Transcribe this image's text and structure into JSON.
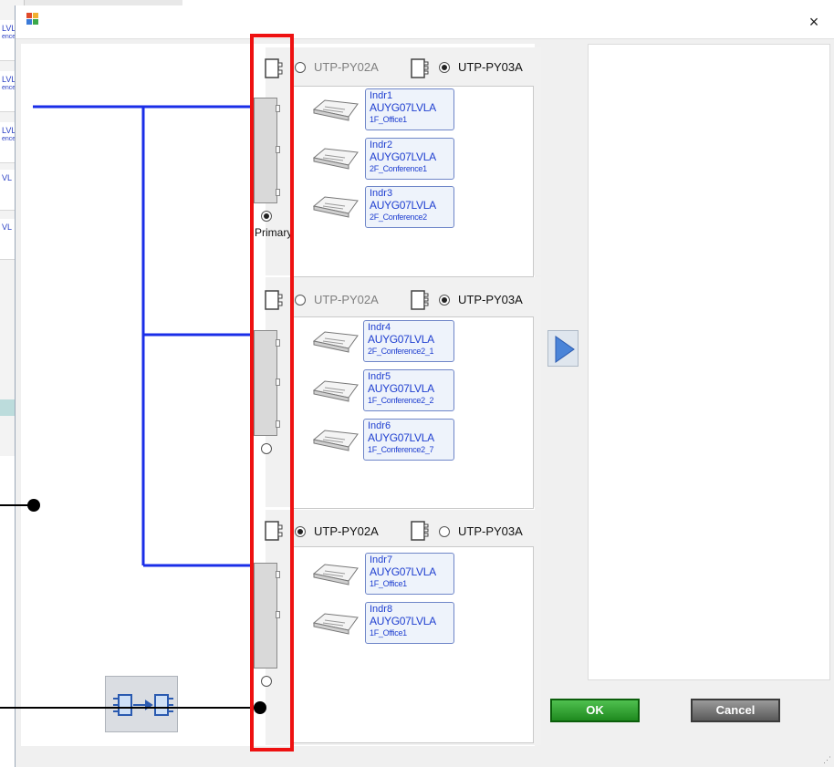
{
  "background_window": {
    "items": [
      {
        "line1": "LVL",
        "line2": "ence"
      },
      {
        "line1": "LVL",
        "line2": "ence"
      },
      {
        "line1": "LVL",
        "line2": "ence"
      },
      {
        "line1": "VL",
        "line2": ""
      },
      {
        "line1": "VL",
        "line2": ""
      }
    ]
  },
  "dialog": {
    "close_glyph": "×"
  },
  "groups": [
    {
      "options": [
        {
          "label": "UTP-PY02A",
          "selected": false,
          "dim": true
        },
        {
          "label": "UTP-PY03A",
          "selected": true,
          "dim": false
        }
      ],
      "units": [
        {
          "name": "Indr1",
          "model": "AUYG07LVLA",
          "room": "1F_Office1"
        },
        {
          "name": "Indr2",
          "model": "AUYG07LVLA",
          "room": "2F_Conference1"
        },
        {
          "name": "Indr3",
          "model": "AUYG07LVLA",
          "room": "2F_Conference2"
        }
      ],
      "primary_selected": true,
      "primary_label": "Primary"
    },
    {
      "options": [
        {
          "label": "UTP-PY02A",
          "selected": false,
          "dim": true
        },
        {
          "label": "UTP-PY03A",
          "selected": true,
          "dim": false
        }
      ],
      "units": [
        {
          "name": "Indr4",
          "model": "AUYG07LVLA",
          "room": "2F_Conference2_1"
        },
        {
          "name": "Indr5",
          "model": "AUYG07LVLA",
          "room": "1F_Conference2_2"
        },
        {
          "name": "Indr6",
          "model": "AUYG07LVLA",
          "room": "1F_Conference2_7"
        }
      ],
      "primary_selected": false
    },
    {
      "options": [
        {
          "label": "UTP-PY02A",
          "selected": true,
          "dim": false
        },
        {
          "label": "UTP-PY03A",
          "selected": false,
          "dim": false
        }
      ],
      "units": [
        {
          "name": "Indr7",
          "model": "AUYG07LVLA",
          "room": "1F_Office1"
        },
        {
          "name": "Indr8",
          "model": "AUYG07LVLA",
          "room": "1F_Office1"
        }
      ],
      "primary_selected": false
    }
  ],
  "buttons": {
    "ok": "OK",
    "cancel": "Cancel"
  },
  "colors": {
    "pipe_line": "#1a2ee8",
    "highlight": "#ee1111",
    "ok_green": "#2e9e2e",
    "card_text": "#1f3fd0"
  },
  "icons": {
    "app": "app-icon",
    "close": "close-icon",
    "add": "arrow-right-icon",
    "swap": "swap-bc-icon",
    "branch_controller": "branch-controller-icon",
    "indoor_unit": "cassette-unit-icon"
  }
}
